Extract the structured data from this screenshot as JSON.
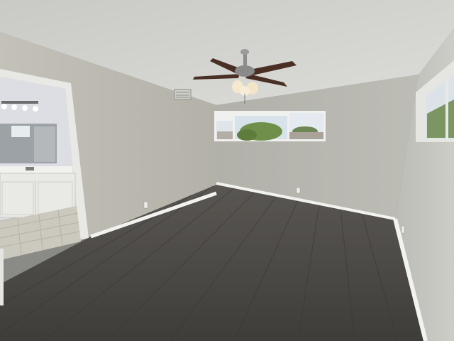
{
  "scene": {
    "description_label": "",
    "colors": {
      "ceiling": "#cfd0cc",
      "wall_left": "#bdbbb2",
      "wall_back": "#b7b7b0",
      "wall_right": "#c4c4be",
      "floor": "#4c4a47",
      "baseboard": "#efefec",
      "door_frame": "#e6e6e2",
      "bath_wall": "#dcdde2",
      "vanity": "#e9eae6",
      "tile": "#c9c6bb",
      "fan_blade": "#4a2f25",
      "fan_metal": "#8d8d8d",
      "window_sky": "#dfe7ee",
      "foliage": "#6f8f4a"
    },
    "icons": [
      "ceiling-fan-icon",
      "hvac-vent-icon",
      "vanity-light-icon",
      "outlet-icon"
    ]
  }
}
